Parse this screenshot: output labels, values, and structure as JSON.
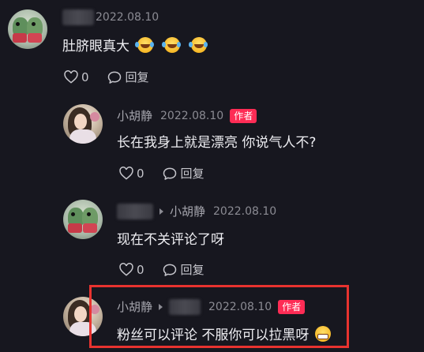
{
  "comments": [
    {
      "username": "",
      "date": "2022.08.10",
      "text": "肚脐眼真大",
      "emoji": [
        "rofl-emoji",
        "rofl-emoji",
        "rofl-emoji"
      ],
      "likes": "0",
      "reply_label": "回复"
    },
    {
      "username": "小胡静",
      "date": "2022.08.10",
      "badge": "作者",
      "text": "长在我身上就是漂亮 你说气人不?",
      "likes": "0",
      "reply_label": "回复"
    },
    {
      "username": "",
      "reply_to": "小胡静",
      "date": "2022.08.10",
      "text": "现在不关评论了呀",
      "likes": "0",
      "reply_label": "回复"
    },
    {
      "username": "小胡静",
      "reply_to": "",
      "date": "2022.08.10",
      "badge": "作者",
      "text": "粉丝可以评论 不服你可以拉黑呀",
      "emoji": [
        "grin-emoji"
      ]
    }
  ],
  "colors": {
    "background": "#17171f",
    "badge": "#fe2c55",
    "highlight": "#e8332f"
  }
}
